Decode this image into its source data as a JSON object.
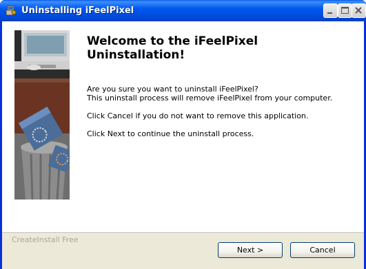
{
  "window": {
    "title": "Uninstalling iFeelPixel",
    "app_icon": "installer-icon",
    "title_bar_color": "#0054e3",
    "controls": [
      "minimize-icon",
      "maximize-icon",
      "close-icon"
    ]
  },
  "content": {
    "heading": "Welcome to the iFeelPixel Uninstallation!",
    "line_confirm": "Are you sure you want to uninstall iFeelPixel?",
    "line_remove": "This uninstall process will remove iFeelPixel from your computer.",
    "line_cancel": "Click Cancel if you do not want to remove this application.",
    "line_next": "Click Next to continue the uninstall process."
  },
  "footer": {
    "brand": "CreateInstall Free",
    "next_label": "Next >",
    "cancel_label": "Cancel"
  },
  "colors": {
    "dialog_background": "#ece9d8",
    "panel_background": "#ffffff",
    "button_border": "#003c74"
  }
}
